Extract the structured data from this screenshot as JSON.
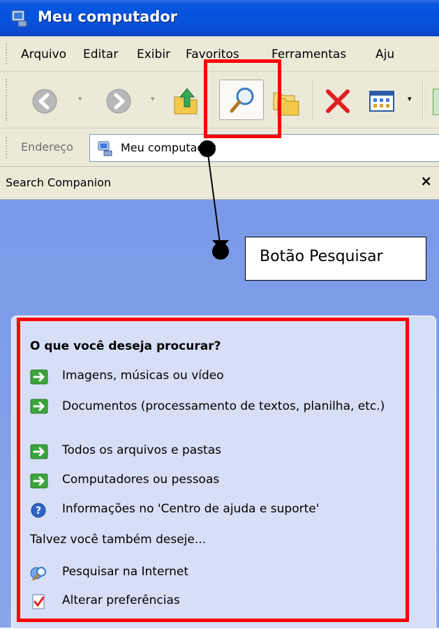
{
  "window": {
    "title": "Meu computador"
  },
  "menu": [
    "Arquivo",
    "Editar",
    "Exibir",
    "Favoritos",
    "Ferramentas",
    "Aju"
  ],
  "toolbar": {
    "icons": [
      "back-icon",
      "forward-icon",
      "up-folder-icon",
      "search-icon",
      "folders-icon",
      "delete-icon",
      "views-icon"
    ]
  },
  "address": {
    "label": "Endereço",
    "value": "Meu computador"
  },
  "companion": {
    "title": "Search Companion",
    "close": "×",
    "question": "O que você deseja procurar?",
    "options": [
      {
        "label": "Imagens, músicas ou vídeo",
        "icon": "green-arrow-icon"
      },
      {
        "label": "Documentos (processamento de textos, planilha, etc.)",
        "icon": "green-arrow-icon"
      },
      {
        "label": "Todos os arquivos e pastas",
        "icon": "green-arrow-icon"
      },
      {
        "label": "Computadores ou pessoas",
        "icon": "green-arrow-icon"
      },
      {
        "label": "Informações no 'Centro de ajuda e suporte'",
        "icon": "help-icon"
      }
    ],
    "maybe_label": "Talvez você também deseje...",
    "extras": [
      {
        "label": "Pesquisar na Internet",
        "icon": "internet-search-icon"
      },
      {
        "label": "Alterar preferências",
        "icon": "preferences-icon"
      }
    ]
  },
  "annotation": {
    "callout": "Botão Pesquisar"
  },
  "colors": {
    "highlight": "#ff0000",
    "titlebar": "#0453dd",
    "pane": "#7f9ee8",
    "panel": "#d7dff7"
  }
}
